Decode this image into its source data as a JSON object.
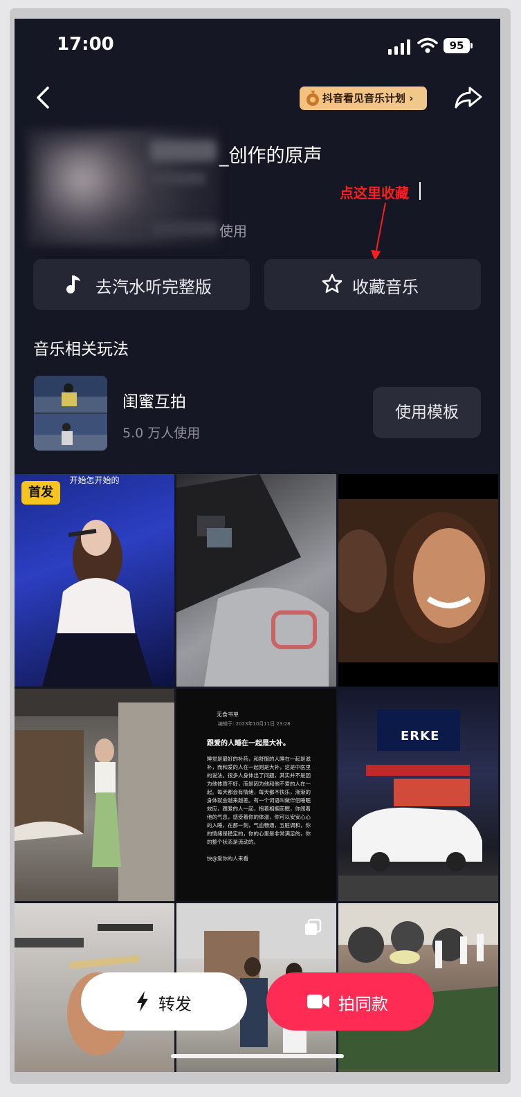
{
  "status_bar": {
    "time": "17:00",
    "battery": "95"
  },
  "header": {
    "promo_label": "抖音看见音乐计划 ›"
  },
  "music": {
    "title_suffix": "_创作的原声",
    "uses_suffix": "使用"
  },
  "annotation": {
    "text": "点这里收藏",
    "color": "#ff1e1e"
  },
  "actions": {
    "full_version_label": "去汽水听完整版",
    "favorite_label": "收藏音乐"
  },
  "related": {
    "section_title": "音乐相关玩法",
    "template_name": "闺蜜互拍",
    "template_uses": "5.0 万人使用",
    "use_template_label": "使用模板"
  },
  "grid": {
    "first_badge": "首发",
    "cell1_caption": "开始怎开始的",
    "doc_title": "无食书单",
    "doc_date": "编辑于: 2023年10月11日 23:28",
    "doc_heading": "跟爱的人睡在一起是大补。",
    "doc_body": "睡觉是最好的补药，和舒服的人睡在一起是滋补，而和爱的人在一起则是大补，这是中医里的说法。很多人身体出了问题，其实并不是因为他体质不好，而是因为他和他不爱的人在一起。每天都会有情绪，每天都不快乐，渐渐的身体就会越来越差。有一个词语叫做伴侣睡眠效应，跟爱的人一起，抱着相拥而眠，你闻着他的气息，感受着你的体温，你可以安安心心的入睡，在那一刻，气血畅通，五脏调和，你的情绪是稳定的，你的心里是非常满足的，你的整个状态是流动的。",
    "doc_footer": "快@爱你的人来看",
    "storefront_sign": "ERKE"
  },
  "bottom": {
    "repost_label": "转发",
    "shoot_label": "拍同款"
  },
  "colors": {
    "background": "#161725",
    "button_bg": "#262734",
    "accent": "#fe2c55",
    "badge": "#f7c31f"
  }
}
